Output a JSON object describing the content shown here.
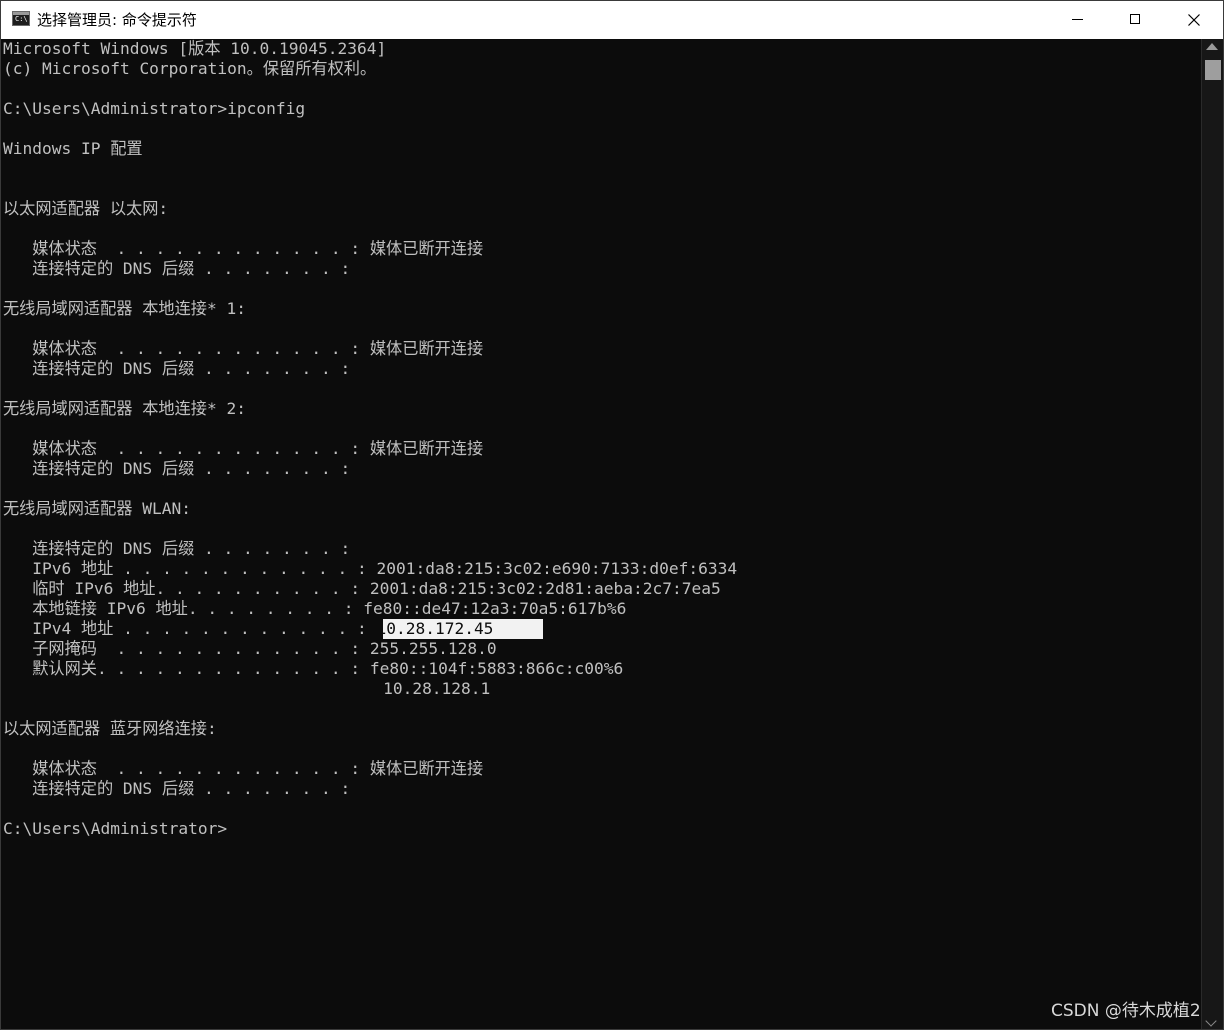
{
  "window": {
    "title": "选择管理员: 命令提示符",
    "app_icon_text": "C:\\"
  },
  "console": {
    "lines": [
      "Microsoft Windows [版本 10.0.19045.2364]",
      "(c) Microsoft Corporation。保留所有权利。",
      "",
      "C:\\Users\\Administrator>ipconfig",
      "",
      "Windows IP 配置",
      "",
      "",
      "以太网适配器 以太网:",
      "",
      "   媒体状态  . . . . . . . . . . . . : 媒体已断开连接",
      "   连接特定的 DNS 后缀 . . . . . . . :",
      "",
      "无线局域网适配器 本地连接* 1:",
      "",
      "   媒体状态  . . . . . . . . . . . . : 媒体已断开连接",
      "   连接特定的 DNS 后缀 . . . . . . . :",
      "",
      "无线局域网适配器 本地连接* 2:",
      "",
      "   媒体状态  . . . . . . . . . . . . : 媒体已断开连接",
      "   连接特定的 DNS 后缀 . . . . . . . :",
      "",
      "无线局域网适配器 WLAN:",
      "",
      "   连接特定的 DNS 后缀 . . . . . . . :",
      "   IPv6 地址 . . . . . . . . . . . . : 2001:da8:215:3c02:e690:7133:d0ef:6334",
      "   临时 IPv6 地址. . . . . . . . . . : 2001:da8:215:3c02:2d81:aeba:2c7:7ea5",
      "   本地链接 IPv6 地址. . . . . . . . : fe80::de47:12a3:70a5:617b%6",
      "   IPv4 地址 . . . . . . . . . . . . : 10.28.172.45",
      "   子网掩码  . . . . . . . . . . . . : 255.255.128.0",
      "   默认网关. . . . . . . . . . . . . : fe80::104f:5883:866c:c00%6",
      "                                       10.28.128.1",
      "",
      "以太网适配器 蓝牙网络连接:",
      "",
      "   媒体状态  . . . . . . . . . . . . : 媒体已断开连接",
      "   连接特定的 DNS 后缀 . . . . . . . :",
      "",
      "C:\\Users\\Administrator>"
    ],
    "selected": {
      "prefix": "   IPv4 地址 . . . . . . . . . . . . : ",
      "text": "10.28.172.45"
    }
  },
  "watermark": "CSDN @待木成植2",
  "colors": {
    "console_background": "#0c0c0c",
    "console_text": "#c0c0c0",
    "selection_background": "#f2f2f2",
    "titlebar_background": "#ffffff"
  }
}
